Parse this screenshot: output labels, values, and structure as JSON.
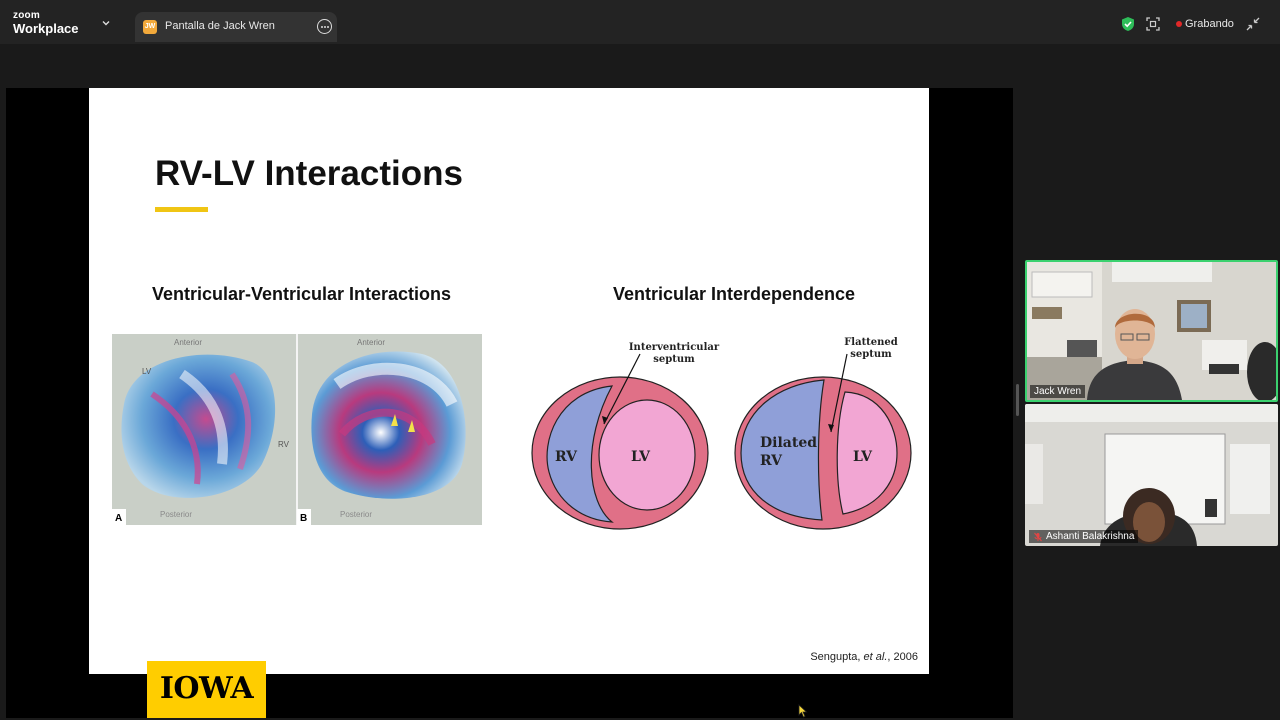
{
  "app": {
    "brand_line1": "zoom",
    "brand_line2": "Workplace"
  },
  "share_tab": {
    "initials": "JW",
    "label": "Pantalla de Jack Wren",
    "icon_color": "#f2a93b"
  },
  "recording": {
    "label": "Grabando",
    "dot_color": "#e02828"
  },
  "slide": {
    "title": "RV-LV Interactions",
    "accent_color": "#f0c514",
    "left_heading": "Ventricular-Ventricular Interactions",
    "right_heading": "Ventricular Interdependence",
    "left_figure": {
      "panel_a_letter": "A",
      "panel_b_letter": "B",
      "top_text_a": "Anterior",
      "top_text_b": "Anterior",
      "bottom_text_a": "Posterior",
      "bottom_text_b": "Posterior",
      "label_lv": "LV",
      "label_rv": "RV"
    },
    "right_figure": {
      "septum_label_line1": "Interventricular",
      "septum_label_line2": "septum",
      "rv_label": "RV",
      "lv_label": "LV",
      "flattened_line1": "Flattened",
      "flattened_line2": "septum",
      "dilated_line1": "Dilated",
      "dilated_line2": "RV",
      "lv_label_2": "LV"
    },
    "citation_prefix": "Sengupta, ",
    "citation_italic": "et al.",
    "citation_suffix": ", 2006"
  },
  "logo": {
    "text": "IOWA",
    "color": "#ffcd00"
  },
  "participants": [
    {
      "name": "Jack Wren",
      "active_speaker": true
    },
    {
      "name": "Ashanti Balakrishna",
      "muted": true
    }
  ],
  "colors": {
    "rv_fill": "#8f9fd8",
    "lv_fill": "#f2a6d3",
    "wall_fill": "#e07087",
    "active_border": "#3bd16f"
  }
}
